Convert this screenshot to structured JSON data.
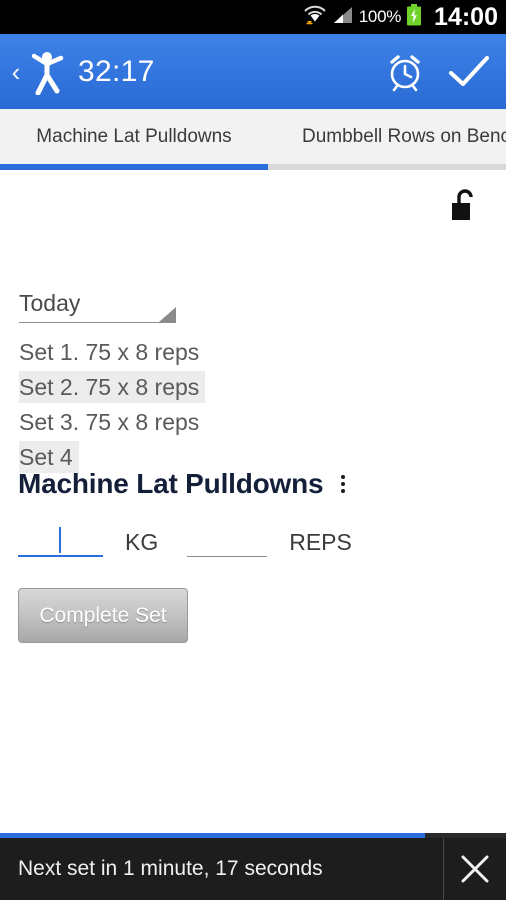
{
  "statusbar": {
    "battery_percent": "100%",
    "clock": "14:00",
    "icons": [
      "wifi-icon",
      "cell-signal-icon",
      "battery-charging-icon"
    ]
  },
  "actionbar": {
    "back_label": "‹",
    "app_icon": "weightlifter-icon",
    "timer": "32:17",
    "alarm_icon": "alarm-clock-icon",
    "done_icon": "checkmark-icon"
  },
  "tabs": [
    {
      "label": "Machine Lat Pulldowns",
      "active": true
    },
    {
      "label": "Dumbbell Rows on Bench",
      "active": false
    }
  ],
  "content": {
    "lock_icon": "open-padlock-icon",
    "date_selector": {
      "value": "Today",
      "caret_icon": "dropdown-caret-icon"
    },
    "sets": [
      {
        "text": "Set 1. 75 x 8 reps",
        "highlighted": false
      },
      {
        "text": "Set 2. 75 x 8 reps",
        "highlighted": true
      },
      {
        "text": "Set 3. 75 x 8 reps",
        "highlighted": false
      },
      {
        "text": "Set 4",
        "highlighted": true
      }
    ],
    "exercise_title": "Machine Lat Pulldowns",
    "overflow_icon": "vertical-dots-icon",
    "weight_input": {
      "value": "",
      "placeholder": ""
    },
    "weight_unit_label": "KG",
    "reps_input": {
      "value": "",
      "placeholder": ""
    },
    "reps_label": "REPS",
    "complete_button": "Complete Set"
  },
  "bottombar": {
    "message": "Next set in 1 minute, 17 seconds",
    "close_icon": "close-x-icon",
    "progress_percent": 84
  },
  "colors": {
    "accent_blue": "#2a6fdb",
    "statusbar_bg": "#000000",
    "bottombar_bg": "#1d1d1d",
    "tab_bg": "#f2f2f2"
  }
}
